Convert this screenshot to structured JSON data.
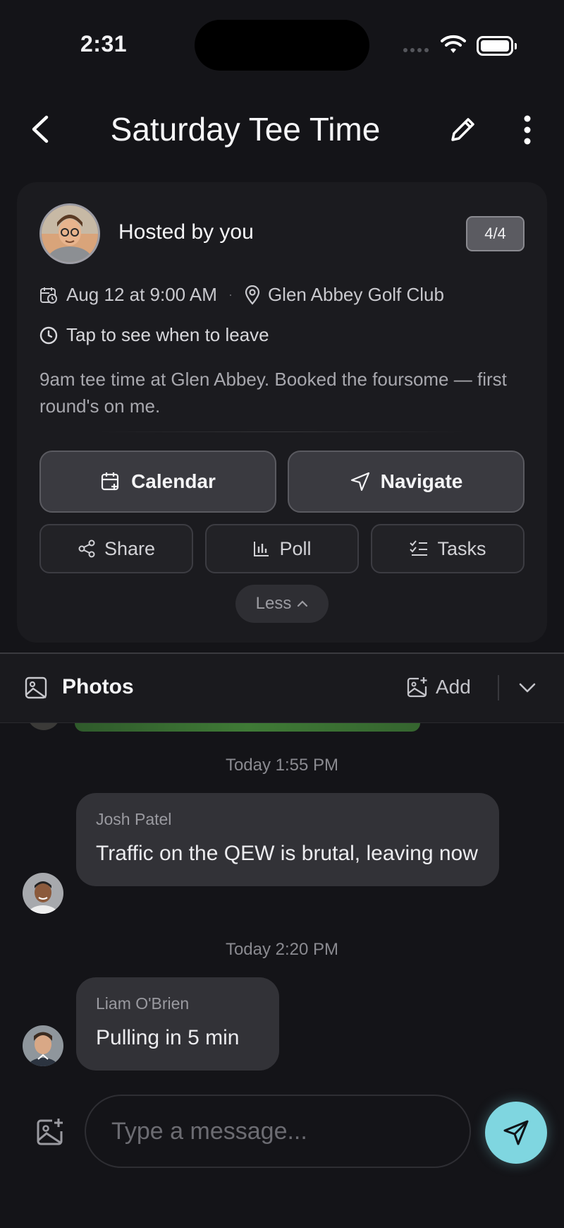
{
  "status_bar": {
    "time": "2:31"
  },
  "header": {
    "title": "Saturday Tee Time"
  },
  "event": {
    "host_label": "Hosted by you",
    "attendee_count": "4/4",
    "date": "Aug 12 at 9:00 AM",
    "separator": "·",
    "location": "Glen Abbey Golf Club",
    "leave_hint": "Tap to see when to leave",
    "description": "9am tee time at Glen Abbey. Booked the foursome — first round's on me.",
    "actions": {
      "calendar": "Calendar",
      "navigate": "Navigate",
      "share": "Share",
      "poll": "Poll",
      "tasks": "Tasks",
      "less": "Less"
    }
  },
  "photos": {
    "label": "Photos",
    "add_label": "Add"
  },
  "chat": {
    "messages": [
      {
        "timestamp": "Today 1:55 PM",
        "sender": "Josh Patel",
        "text": "Traffic on the QEW is brutal, leaving now"
      },
      {
        "timestamp": "Today 2:20 PM",
        "sender": "Liam O'Brien",
        "text": "Pulling in 5 min"
      }
    ]
  },
  "composer": {
    "placeholder": "Type a message..."
  },
  "colors": {
    "background": "#141418",
    "card": "#1b1b1f",
    "bubble": "#323237",
    "send_accent": "#7fd6e0"
  }
}
